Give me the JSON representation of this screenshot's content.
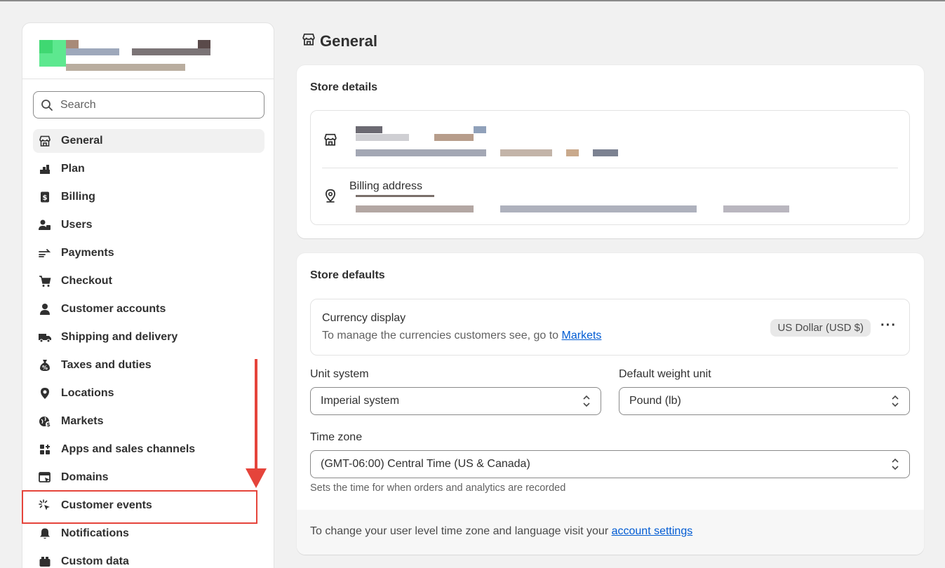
{
  "sidebar": {
    "search_placeholder": "Search",
    "items": [
      {
        "label": "General",
        "icon": "store-icon",
        "active": true
      },
      {
        "label": "Plan",
        "icon": "plan-icon"
      },
      {
        "label": "Billing",
        "icon": "billing-icon"
      },
      {
        "label": "Users",
        "icon": "users-icon"
      },
      {
        "label": "Payments",
        "icon": "payments-icon"
      },
      {
        "label": "Checkout",
        "icon": "cart-icon"
      },
      {
        "label": "Customer accounts",
        "icon": "person-icon"
      },
      {
        "label": "Shipping and delivery",
        "icon": "truck-icon"
      },
      {
        "label": "Taxes and duties",
        "icon": "tax-icon"
      },
      {
        "label": "Locations",
        "icon": "location-pin-icon"
      },
      {
        "label": "Markets",
        "icon": "globe-icon"
      },
      {
        "label": "Apps and sales channels",
        "icon": "apps-icon"
      },
      {
        "label": "Domains",
        "icon": "domains-icon"
      },
      {
        "label": "Customer events",
        "icon": "cursor-click-icon"
      },
      {
        "label": "Notifications",
        "icon": "bell-icon"
      },
      {
        "label": "Custom data",
        "icon": "custom-data-icon"
      }
    ]
  },
  "main": {
    "title": "General",
    "store_details": {
      "heading": "Store details",
      "billing_label": "Billing address"
    },
    "store_defaults": {
      "heading": "Store defaults",
      "currency": {
        "title": "Currency display",
        "desc": "To manage the currencies customers see, go to",
        "link": "Markets",
        "value": "US Dollar (USD $)"
      },
      "unit_system": {
        "label": "Unit system",
        "value": "Imperial system"
      },
      "weight_unit": {
        "label": "Default weight unit",
        "value": "Pound (lb)"
      },
      "time_zone": {
        "label": "Time zone",
        "value": "(GMT-06:00) Central Time (US & Canada)",
        "help": "Sets the time for when orders and analytics are recorded"
      },
      "footer": {
        "text": "To change your user level time zone and language visit your",
        "link": "account settings"
      }
    }
  },
  "colors": {
    "accent_link": "#005bd3",
    "annotation_red": "#e5443b"
  }
}
